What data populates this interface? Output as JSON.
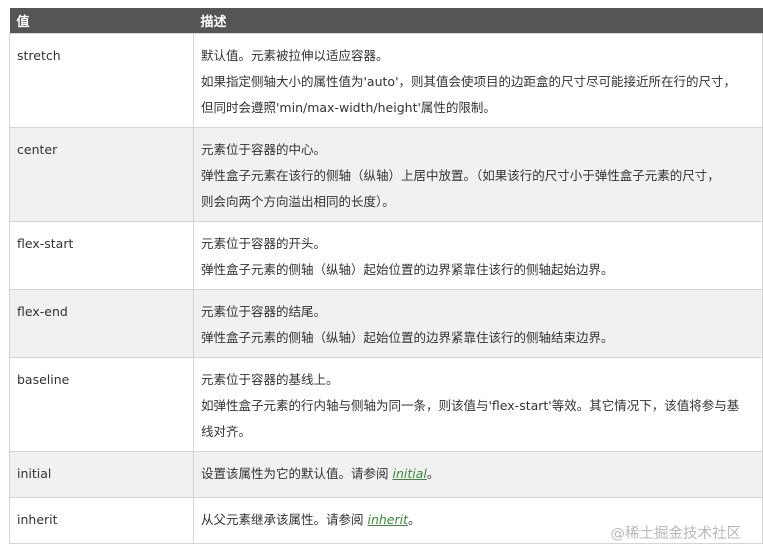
{
  "header": {
    "col_value": "值",
    "col_desc": "描述"
  },
  "rows": [
    {
      "value": "stretch",
      "lines": [
        "默认值。元素被拉伸以适应容器。",
        "如果指定侧轴大小的属性值为'auto'，则其值会使项目的边距盒的尺寸尽可能接近所在行的尺寸，",
        "但同时会遵照'min/max-width/height'属性的限制。"
      ]
    },
    {
      "value": "center",
      "lines": [
        "元素位于容器的中心。",
        "弹性盒子元素在该行的侧轴（纵轴）上居中放置。（如果该行的尺寸小于弹性盒子元素的尺寸，",
        "则会向两个方向溢出相同的长度）。"
      ]
    },
    {
      "value": "flex-start",
      "lines": [
        "元素位于容器的开头。",
        "弹性盒子元素的侧轴（纵轴）起始位置的边界紧靠住该行的侧轴起始边界。"
      ]
    },
    {
      "value": "flex-end",
      "lines": [
        "元素位于容器的结尾。",
        "弹性盒子元素的侧轴（纵轴）起始位置的边界紧靠住该行的侧轴结束边界。"
      ]
    },
    {
      "value": "baseline",
      "lines": [
        "元素位于容器的基线上。",
        "如弹性盒子元素的行内轴与侧轴为同一条，则该值与'flex-start'等效。其它情况下，该值将参与基",
        "线对齐。"
      ]
    },
    {
      "value": "initial",
      "lines": [
        "设置该属性为它的默认值。请参阅 "
      ],
      "link": "initial",
      "suffix": "。"
    },
    {
      "value": "inherit",
      "lines": [
        "从父元素继承该属性。请参阅 "
      ],
      "link": "inherit",
      "suffix": "。"
    }
  ],
  "watermark": "@稀土掘金技术社区"
}
